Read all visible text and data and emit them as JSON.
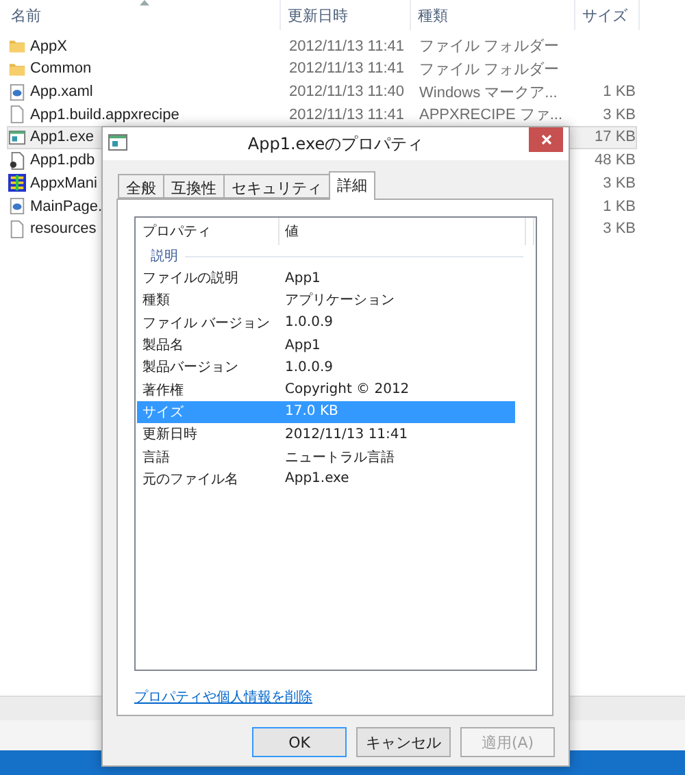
{
  "explorer": {
    "columns": [
      {
        "label": "名前",
        "sorted": true
      },
      {
        "label": "更新日時",
        "sorted": false
      },
      {
        "label": "種類",
        "sorted": false
      },
      {
        "label": "サイズ",
        "sorted": false
      }
    ],
    "files": [
      {
        "name": "AppX",
        "date": "2012/11/13 11:41",
        "type": "ファイル フォルダー",
        "kind": "folder",
        "selected": false
      },
      {
        "name": "Common",
        "date": "2012/11/13 11:41",
        "type": "ファイル フォルダー",
        "kind": "folder",
        "selected": false
      },
      {
        "name": "App.xaml",
        "date": "2012/11/13 11:40",
        "type": "Windows マークア...",
        "size": "1 KB",
        "kind": "xaml",
        "selected": false
      },
      {
        "name": "App1.build.appxrecipe",
        "date": "2012/11/13 11:41",
        "type": "APPXRECIPE ファ...",
        "size": "3 KB",
        "kind": "document",
        "selected": false
      },
      {
        "name": "App1.exe",
        "size": "17 KB",
        "kind": "exe",
        "selected": true
      },
      {
        "name": "App1.pdb",
        "size": "48 KB",
        "kind": "pdb",
        "selected": false
      },
      {
        "name": "AppxMani",
        "size": "3 KB",
        "kind": "manifest",
        "selected": false
      },
      {
        "name": "MainPage.",
        "size": "1 KB",
        "kind": "xaml",
        "selected": false
      },
      {
        "name": "resources",
        "size": "3 KB",
        "kind": "document",
        "selected": false
      }
    ]
  },
  "dialog": {
    "title": "App1.exeのプロパティ",
    "tabs": [
      {
        "label": "全般",
        "selected": false
      },
      {
        "label": "互換性",
        "selected": false
      },
      {
        "label": "セキュリティ",
        "selected": false
      },
      {
        "label": "詳細",
        "selected": true
      }
    ],
    "columns": [
      "プロパティ",
      "値"
    ],
    "group": "説明",
    "properties": [
      {
        "name": "ファイルの説明",
        "value": "App1",
        "selected": false
      },
      {
        "name": "種類",
        "value": "アプリケーション",
        "selected": false
      },
      {
        "name": "ファイル バージョン",
        "value": "1.0.0.9",
        "selected": false
      },
      {
        "name": "製品名",
        "value": "App1",
        "selected": false
      },
      {
        "name": "製品バージョン",
        "value": "1.0.0.9",
        "selected": false
      },
      {
        "name": "著作権",
        "value": "Copyright ©  2012",
        "selected": false
      },
      {
        "name": "サイズ",
        "value": "17.0 KB",
        "selected": true
      },
      {
        "name": "更新日時",
        "value": "2012/11/13 11:41",
        "selected": false
      },
      {
        "name": "言語",
        "value": "ニュートラル言語",
        "selected": false
      },
      {
        "name": "元のファイル名",
        "value": "App1.exe",
        "selected": false
      }
    ],
    "link": "プロパティや個人情報を削除",
    "buttons": [
      {
        "label": "OK",
        "kind": "default",
        "disabled": false
      },
      {
        "label": "キャンセル",
        "kind": "normal",
        "disabled": false
      },
      {
        "label": "適用(A)",
        "kind": "normal",
        "disabled": true
      }
    ]
  }
}
